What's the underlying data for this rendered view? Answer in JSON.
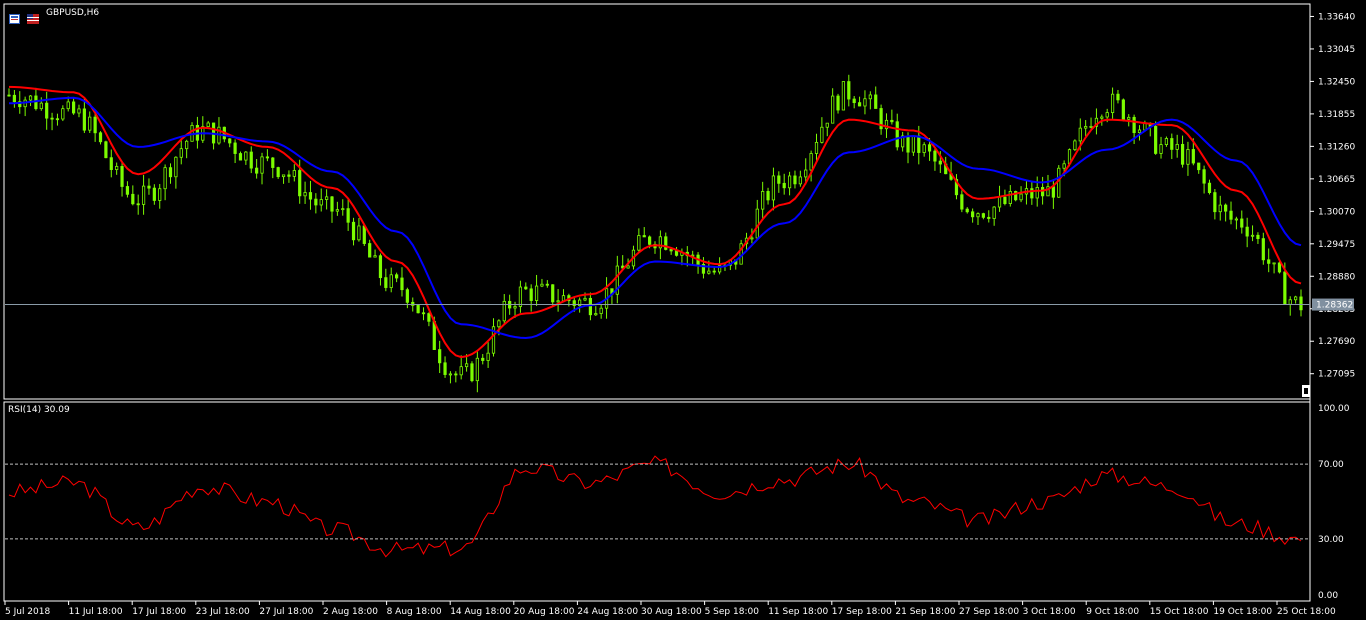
{
  "window": {
    "symbol_label": "GBPUSD,H6",
    "icons": [
      "chart-window-icon",
      "flag-icon"
    ]
  },
  "indicator": {
    "label": "RSI(14) 30.09",
    "levels": [
      70,
      30
    ],
    "scale_labels": [
      "100.00",
      "70.00",
      "30.00",
      "0.00"
    ]
  },
  "price_axis": {
    "labels": [
      "1.33640",
      "1.33045",
      "1.32450",
      "1.31855",
      "1.31260",
      "1.30665",
      "1.30070",
      "1.29475",
      "1.28880",
      "1.28285",
      "1.27690",
      "1.27095"
    ],
    "current_price": "1.28362"
  },
  "time_axis": {
    "labels": [
      "5 Jul 2018",
      "11 Jul 18:00",
      "17 Jul 18:00",
      "23 Jul 18:00",
      "27 Jul 18:00",
      "2 Aug 18:00",
      "8 Aug 18:00",
      "14 Aug 18:00",
      "20 Aug 18:00",
      "24 Aug 18:00",
      "30 Aug 18:00",
      "5 Sep 18:00",
      "11 Sep 18:00",
      "17 Sep 18:00",
      "21 Sep 18:00",
      "27 Sep 18:00",
      "3 Oct 18:00",
      "9 Oct 18:00",
      "15 Oct 18:00",
      "19 Oct 18:00",
      "25 Oct 18:00"
    ]
  },
  "colors": {
    "background": "#000000",
    "candles": "#7CFC00",
    "ma_fast": "#FF0000",
    "ma_slow": "#0000FF",
    "rsi": "#FF0000",
    "grid_text": "#FFFFFF",
    "level_line": "#808080",
    "price_line": "#708090"
  },
  "chart_data": {
    "type": "line",
    "symbol": "GBPUSD",
    "timeframe": "H6",
    "ylim": [
      1.2665,
      1.3385
    ],
    "x": [
      "5 Jul 2018",
      "11 Jul 18:00",
      "17 Jul 18:00",
      "23 Jul 18:00",
      "27 Jul 18:00",
      "2 Aug 18:00",
      "8 Aug 18:00",
      "14 Aug 18:00",
      "20 Aug 18:00",
      "24 Aug 18:00",
      "30 Aug 18:00",
      "5 Sep 18:00",
      "11 Sep 18:00",
      "17 Sep 18:00",
      "21 Sep 18:00",
      "27 Sep 18:00",
      "3 Oct 18:00",
      "9 Oct 18:00",
      "15 Oct 18:00",
      "19 Oct 18:00",
      "25 Oct 18:00"
    ],
    "series": [
      {
        "values": [
          1.322,
          1.3185,
          1.303,
          1.3155,
          1.3095,
          1.301,
          1.287,
          1.2705,
          1.286,
          1.284,
          1.296,
          1.2895,
          1.3065,
          1.3225,
          1.3125,
          1.301,
          1.304,
          1.3205,
          1.312,
          1.299,
          1.2836
        ]
      },
      {
        "values": [
          1.3235,
          1.3225,
          1.3075,
          1.316,
          1.3125,
          1.305,
          1.2915,
          1.274,
          1.282,
          1.2855,
          1.2945,
          1.291,
          1.302,
          1.3175,
          1.3155,
          1.303,
          1.3045,
          1.3175,
          1.3165,
          1.3045,
          1.2875
        ]
      },
      {
        "values": [
          1.3205,
          1.3215,
          1.3125,
          1.315,
          1.3135,
          1.308,
          1.297,
          1.28,
          1.2775,
          1.2835,
          1.2915,
          1.2905,
          1.2985,
          1.3115,
          1.3145,
          1.3085,
          1.306,
          1.312,
          1.3175,
          1.31,
          1.2945
        ]
      }
    ],
    "rsi": {
      "ylim": [
        0,
        100
      ],
      "values": [
        55,
        60,
        36,
        58,
        50,
        35,
        24,
        25,
        68,
        60,
        70,
        55,
        62,
        70,
        50,
        40,
        50,
        64,
        58,
        38,
        30.09
      ]
    }
  }
}
